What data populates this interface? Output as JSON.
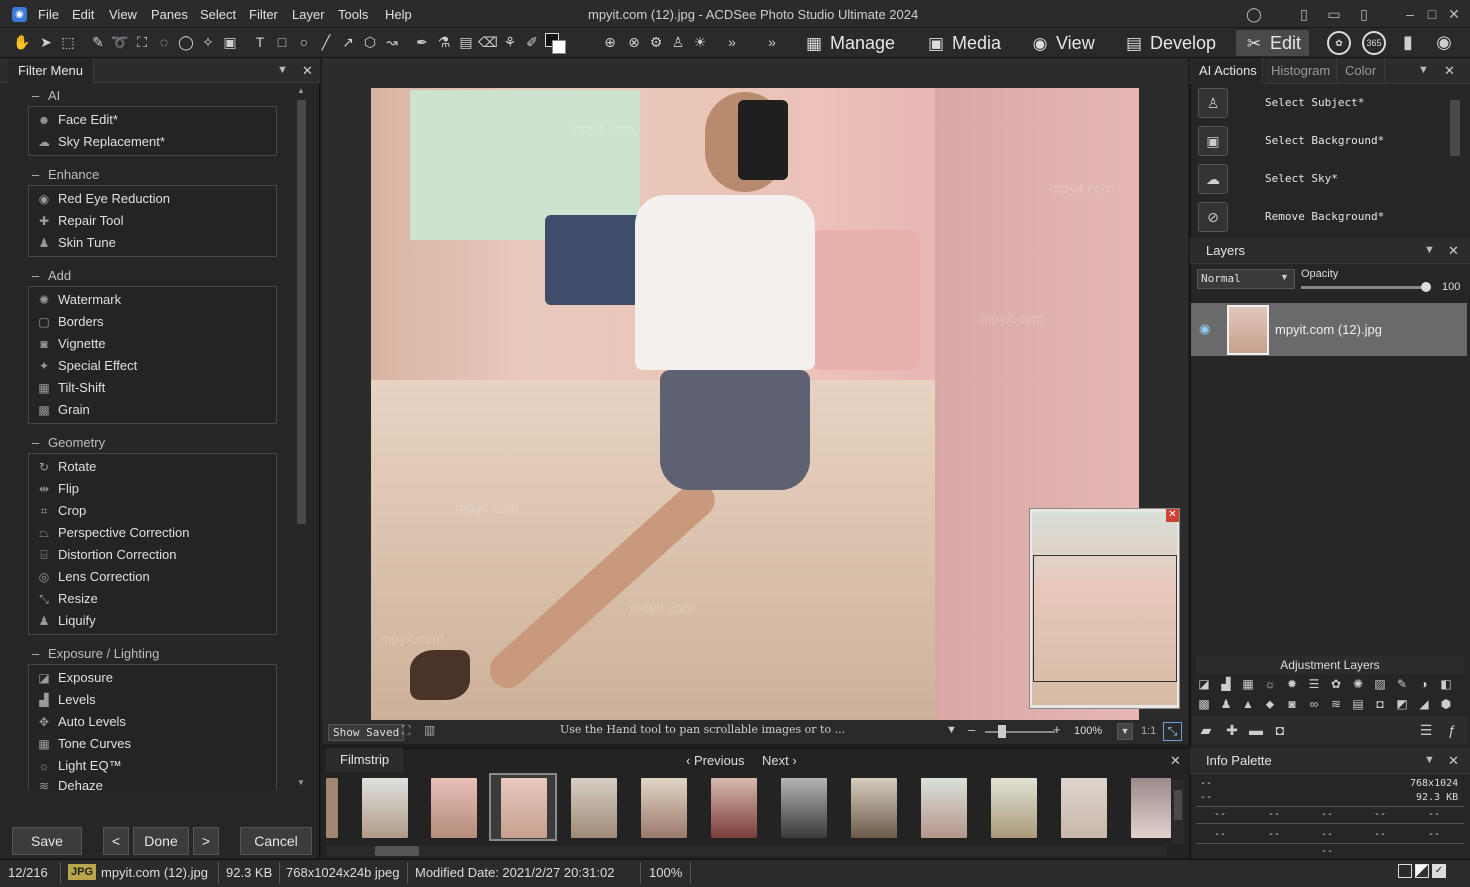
{
  "window": {
    "title": "mpyit.com (12).jpg - ACDSee Photo Studio Ultimate 2024",
    "menu": [
      "File",
      "Edit",
      "View",
      "Panes",
      "Select",
      "Filter",
      "Layer",
      "Tools",
      "Help"
    ]
  },
  "modes": {
    "manage": "Manage",
    "media": "Media",
    "view": "View",
    "develop": "Develop",
    "edit": "Edit",
    "badge_365": "365"
  },
  "filter_menu": {
    "tab": "Filter Menu",
    "groups": [
      {
        "title": "AI",
        "items": [
          "Face Edit*",
          "Sky Replacement*"
        ]
      },
      {
        "title": "Enhance",
        "items": [
          "Red Eye Reduction",
          "Repair Tool",
          "Skin Tune"
        ]
      },
      {
        "title": "Add",
        "items": [
          "Watermark",
          "Borders",
          "Vignette",
          "Special Effect",
          "Tilt-Shift",
          "Grain"
        ]
      },
      {
        "title": "Geometry",
        "items": [
          "Rotate",
          "Flip",
          "Crop",
          "Perspective Correction",
          "Distortion Correction",
          "Lens Correction",
          "Resize",
          "Liquify"
        ]
      },
      {
        "title": "Exposure / Lighting",
        "items": [
          "Exposure",
          "Levels",
          "Auto Levels",
          "Tone Curves",
          "Light EQ™",
          "Dehaze"
        ]
      }
    ],
    "buttons": {
      "save": "Save",
      "done": "Done",
      "cancel": "Cancel"
    }
  },
  "canvas": {
    "show_saved": "Show Saved",
    "hint": "Use the Hand tool to pan scrollable images or to ...",
    "zoom": "100%",
    "ratio": "1:1",
    "watermark": "mpyit.com"
  },
  "filmstrip": {
    "tab": "Filmstrip",
    "previous": "Previous",
    "next": "Next"
  },
  "right_panel": {
    "tabs": [
      "AI Actions",
      "Histogram",
      "Color"
    ],
    "ai_actions": [
      "Select Subject*",
      "Select Background*",
      "Select Sky*",
      "Remove Background*"
    ],
    "layers": {
      "title": "Layers",
      "blend_mode": "Normal",
      "opacity_label": "Opacity",
      "opacity_value": "100",
      "layer_name": "mpyit.com (12).jpg"
    },
    "adjustment_layers_title": "Adjustment Layers",
    "info_palette": {
      "title": "Info Palette",
      "dim": "768x1024",
      "size": "92.3 KB",
      "dash": "--"
    }
  },
  "statusbar": {
    "index": "12/216",
    "format": "JPG",
    "filename": "mpyit.com (12).jpg",
    "filesize": "92.3 KB",
    "image_info": "768x1024x24b jpeg",
    "modified": "Modified Date: 2021/2/27 20:31:02",
    "zoom": "100%"
  },
  "colors": {
    "panel_bg": "#262626",
    "active_mode": "#4a4a4a",
    "layer_selected": "#6a6a6a"
  }
}
